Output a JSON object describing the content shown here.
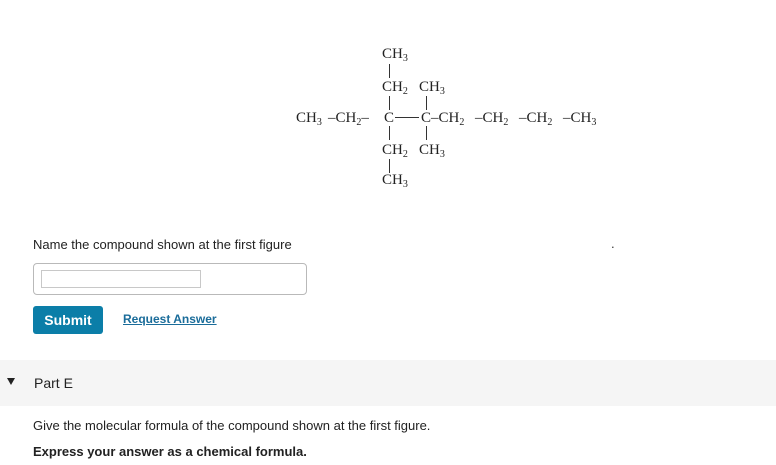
{
  "molecule": {
    "top_ch3": "CH",
    "upper_ch2": "CH",
    "upper_ch3": "CH",
    "main_left": "CH",
    "main_left2": "–CH",
    "main_right": "–CH",
    "main_right2": "–CH",
    "main_right3": "–CH",
    "main_right4": "–CH",
    "carbon": "C",
    "lower_ch2": "CH",
    "lower_ch3": "CH",
    "bottom_ch3": "CH",
    "sub2": "2",
    "sub3": "3"
  },
  "question": {
    "prompt": "Name the compound shown at the first figure",
    "trailing_dot": ".",
    "submit_label": "Submit",
    "request_label": "Request Answer"
  },
  "part": {
    "title": "Part E",
    "text": "Give the molecular formula of the compound shown at the first figure.",
    "instruction": "Express your answer as a chemical formula."
  },
  "colors": {
    "submit_bg": "#0b7ea8",
    "link": "#1a6c9a",
    "part_bar_bg": "#f5f5f5"
  }
}
